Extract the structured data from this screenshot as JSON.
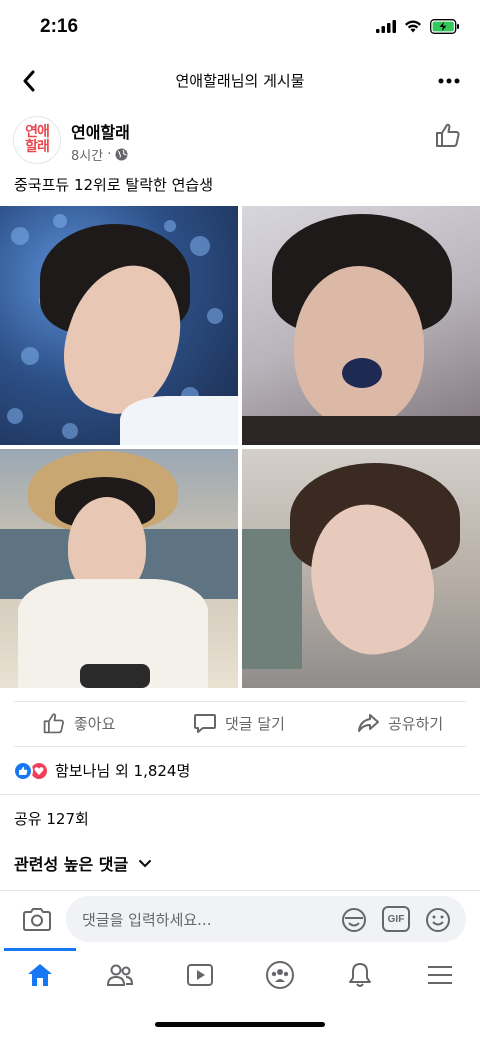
{
  "status_bar": {
    "time": "2:16",
    "icons": [
      "signal-icon",
      "wifi-icon",
      "battery-charging-icon"
    ],
    "battery_color": "#34c759"
  },
  "nav": {
    "title": "연애할래님의 게시물",
    "back_icon": "back-chevron-icon",
    "more_icon": "more-horizontal-icon"
  },
  "post": {
    "avatar_text": [
      "연애",
      "할래"
    ],
    "avatar_color": "#e5484d",
    "page_name": "연애할래",
    "time": "8시간",
    "separator": "·",
    "privacy_icon": "globe-icon",
    "text": "중국프듀 12위로 탈락한 연습생",
    "photos": [
      "photo-blue-flowers",
      "photo-blueberry",
      "photo-straw-hat",
      "photo-smile"
    ]
  },
  "actions": {
    "like": "좋아요",
    "comment": "댓글 달기",
    "share": "공유하기"
  },
  "reactions": {
    "summary": "함보나님 외 1,824명",
    "types": [
      "like-reaction-icon",
      "love-reaction-icon"
    ]
  },
  "shares": "공유 127회",
  "comments_sort": "관련성 높은 댓글",
  "composer": {
    "placeholder": "댓글을 입력하세요...",
    "gif_label": "GIF"
  },
  "tabs": [
    "home-icon",
    "friends-icon",
    "watch-icon",
    "groups-icon",
    "notifications-icon",
    "menu-icon"
  ],
  "colors": {
    "accent": "#1877f2",
    "secondary_text": "#65676b",
    "divider": "#e4e6eb"
  }
}
